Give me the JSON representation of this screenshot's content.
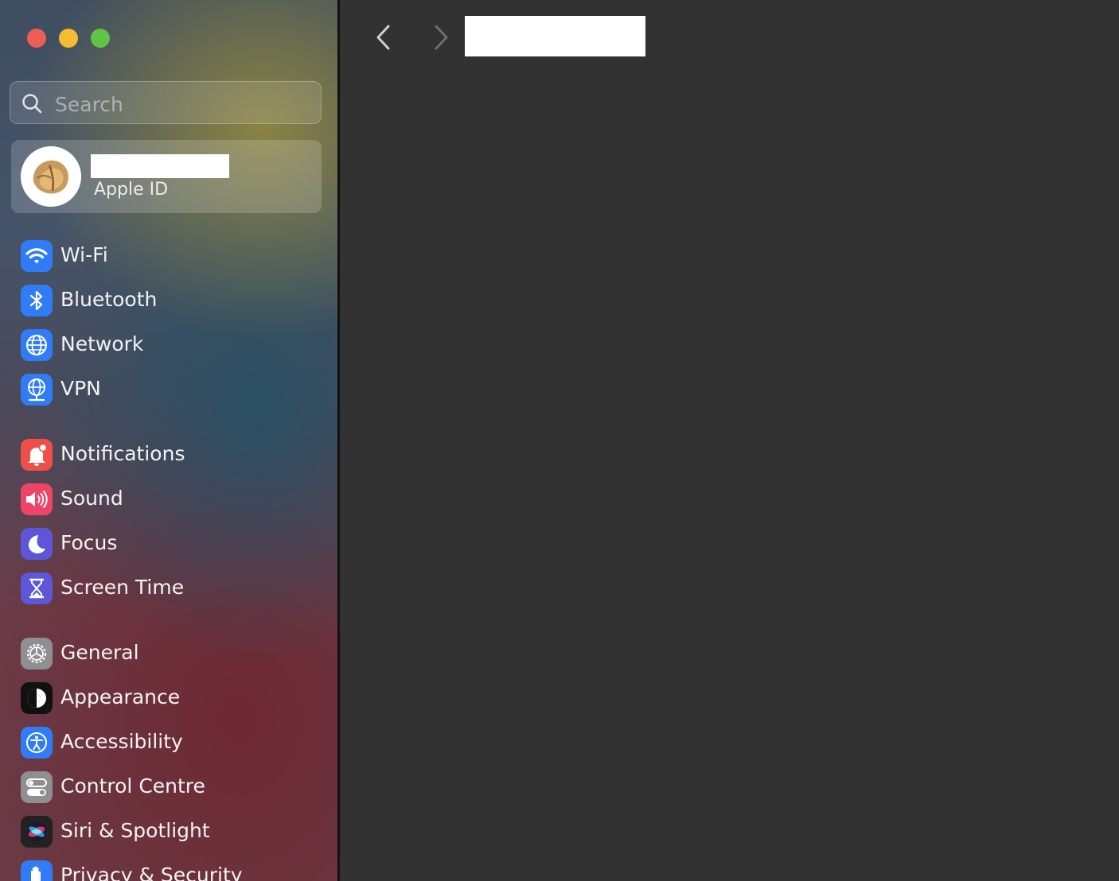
{
  "window": {
    "traffic_lights": [
      "close",
      "minimize",
      "zoom"
    ]
  },
  "search": {
    "placeholder": "Search",
    "icon": "magnifying-glass-icon"
  },
  "account": {
    "name": "",
    "subtitle": "Apple ID",
    "avatar_icon": "fortune-cookie-avatar"
  },
  "sidebar": {
    "items": [
      {
        "label": "Wi-Fi",
        "icon": "wifi-icon",
        "color": "#2f7cf6"
      },
      {
        "label": "Bluetooth",
        "icon": "bluetooth-icon",
        "color": "#2f7cf6"
      },
      {
        "label": "Network",
        "icon": "globe-icon",
        "color": "#2f7cf6"
      },
      {
        "label": "VPN",
        "icon": "vpn-globe-icon",
        "color": "#2f7cf6"
      },
      {
        "label": "Notifications",
        "icon": "bell-icon",
        "color": "#ee4f4a"
      },
      {
        "label": "Sound",
        "icon": "speaker-icon",
        "color": "#ee4467"
      },
      {
        "label": "Focus",
        "icon": "moon-icon",
        "color": "#5e56d8"
      },
      {
        "label": "Screen Time",
        "icon": "hourglass-icon",
        "color": "#5e56d8"
      },
      {
        "label": "General",
        "icon": "gear-icon",
        "color": "#8e8e93"
      },
      {
        "label": "Appearance",
        "icon": "appearance-icon",
        "color": "#111111"
      },
      {
        "label": "Accessibility",
        "icon": "accessibility-icon",
        "color": "#2f7cf6"
      },
      {
        "label": "Control Centre",
        "icon": "toggles-icon",
        "color": "#8e8e93"
      },
      {
        "label": "Siri & Spotlight",
        "icon": "siri-icon",
        "color": "#222222"
      },
      {
        "label": "Privacy & Security",
        "icon": "hand-icon",
        "color": "#2f7cf6"
      }
    ]
  },
  "toolbar": {
    "back_icon": "chevron-left-icon",
    "forward_icon": "chevron-right-icon",
    "title": ""
  }
}
